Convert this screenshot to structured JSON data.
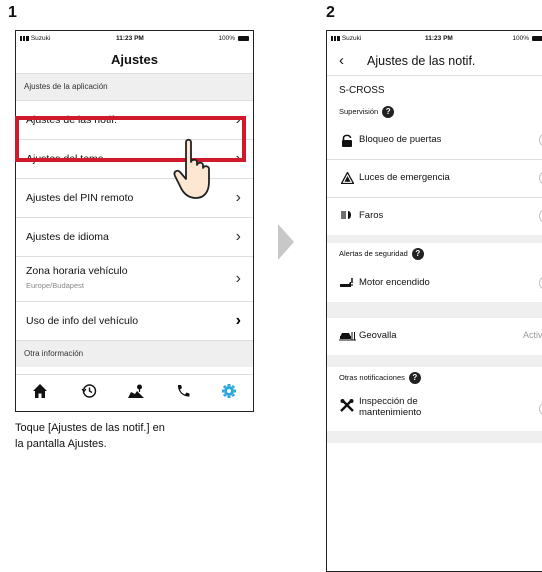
{
  "steps": [
    "1",
    "2"
  ],
  "caption": [
    "Toque [Ajustes de las notif.] en",
    "la pantalla Ajustes."
  ],
  "left_phone": {
    "status": {
      "carrier": "Suzuki",
      "time": "11:23 PM",
      "battery": "100%"
    },
    "title": "Ajustes",
    "section_app": "Ajustes de la aplicación",
    "items": [
      {
        "label": "Ajustes de las notif."
      },
      {
        "label": "Ajustes del tema"
      },
      {
        "label": "Ajustes del PIN remoto"
      },
      {
        "label": "Ajustes de idioma"
      },
      {
        "label": "Zona horaria vehículo",
        "sub": "Europe/Budapest"
      },
      {
        "label": "Uso de info del vehículo"
      }
    ],
    "section_other": "Otra información",
    "tabs": [
      "home-icon",
      "history-icon",
      "map-icon",
      "phone-icon",
      "gear-icon"
    ],
    "colors": {
      "highlight": "#d0192b",
      "active_tab": "#29a8e0"
    }
  },
  "right_phone": {
    "status": {
      "carrier": "Suzuki",
      "time": "11:23 PM",
      "battery": "100%"
    },
    "title": "Ajustes de las notif.",
    "vehicle": "S-CROSS",
    "supervision": {
      "title": "Supervisión",
      "items": [
        {
          "label": "Bloqueo de puertas",
          "icon": "lock-icon",
          "on": false
        },
        {
          "label": "Luces de emergencia",
          "icon": "hazard-icon",
          "on": false
        },
        {
          "label": "Faros",
          "icon": "headlight-icon",
          "on": false
        }
      ]
    },
    "security": {
      "title": "Alertas de seguridad",
      "items": [
        {
          "label": "Motor encendido",
          "icon": "engine-icon",
          "on": false
        }
      ]
    },
    "geofence": {
      "label": "Geovalla",
      "icon": "geofence-icon",
      "status": "Activo"
    },
    "other": {
      "title": "Otras notificaciones",
      "items": [
        {
          "label": "Inspección de",
          "label2": "mantenimiento",
          "icon": "wrench-icon",
          "on": false
        }
      ]
    }
  }
}
